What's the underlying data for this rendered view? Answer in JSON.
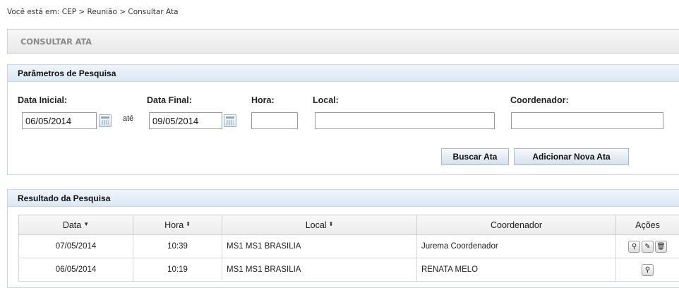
{
  "breadcrumb": {
    "text": "Você está em: CEP > Reunião > Consultar Ata"
  },
  "page": {
    "title": "CONSULTAR ATA"
  },
  "search": {
    "title": "Parâmetros de Pesquisa",
    "data_inicial_label": "Data Inicial:",
    "data_inicial_value": "06/05/2014",
    "ate_label": "até",
    "data_final_label": "Data Final:",
    "data_final_value": "09/05/2014",
    "hora_label": "Hora:",
    "hora_value": "",
    "local_label": "Local:",
    "local_value": "",
    "coordenador_label": "Coordenador:",
    "coordenador_value": "",
    "buscar_label": "Buscar Ata",
    "adicionar_label": "Adicionar Nova Ata"
  },
  "results": {
    "title": "Resultado da Pesquisa",
    "columns": {
      "data": "Data",
      "hora": "Hora",
      "local": "Local",
      "coordenador": "Coordenador",
      "acoes": "Ações"
    },
    "rows": [
      {
        "data": "07/05/2014",
        "hora": "10:39",
        "local": "MS1 MS1 BRASILIA",
        "coordenador": "Jurema Coordenador",
        "actions": [
          "view-icon",
          "edit-icon",
          "delete-icon"
        ]
      },
      {
        "data": "06/05/2014",
        "hora": "10:19",
        "local": "MS1 MS1 BRASILIA",
        "coordenador": "RENATA MELO",
        "actions": [
          "view-icon"
        ]
      }
    ]
  }
}
